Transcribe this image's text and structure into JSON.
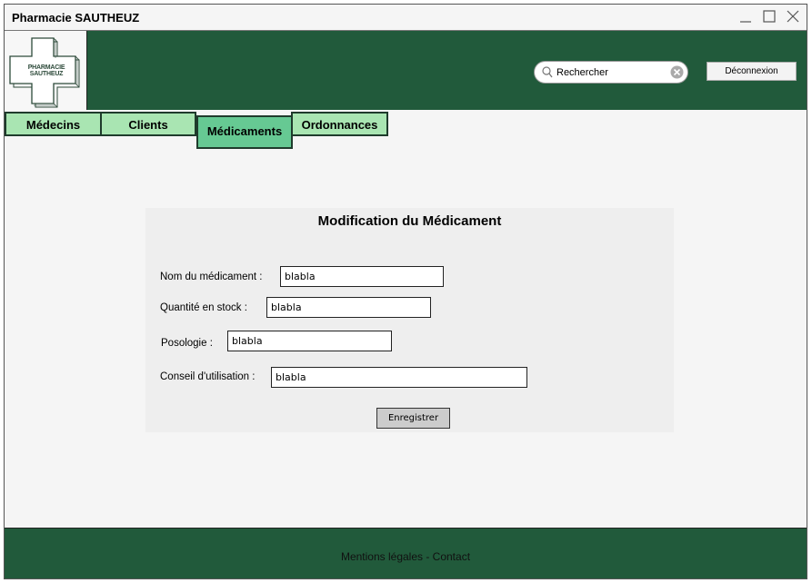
{
  "window": {
    "title": "Pharmacie SAUTHEUZ",
    "controls": [
      "minimize-icon",
      "maximize-icon",
      "close-icon"
    ]
  },
  "header": {
    "logo_text": "PHARMACIE SAUTHEUZ",
    "search": {
      "placeholder": "Rechercher",
      "value": "Rechercher"
    },
    "logout_label": "Déconnexion"
  },
  "tabs": [
    {
      "label": "Médecins",
      "active": false
    },
    {
      "label": "Clients",
      "active": false
    },
    {
      "label": "Médicaments",
      "active": true
    },
    {
      "label": "Ordonnances",
      "active": false
    }
  ],
  "form": {
    "title": "Modification du Médicament",
    "fields": [
      {
        "label": "Nom du médicament :",
        "value": "blabla"
      },
      {
        "label": "Quantité en stock :",
        "value": "blabla"
      },
      {
        "label": "Posologie :",
        "value": "blabla"
      },
      {
        "label": "Conseil d'utilisation :",
        "value": "blabla"
      }
    ],
    "submit_label": "Enregistrer"
  },
  "footer": {
    "text": "Mentions légales - Contact"
  },
  "colors": {
    "header_bg": "#215a3b",
    "tab_bg": "#a9e5b2",
    "tab_active_bg": "#66c993",
    "panel_bg": "#eeeeee"
  }
}
